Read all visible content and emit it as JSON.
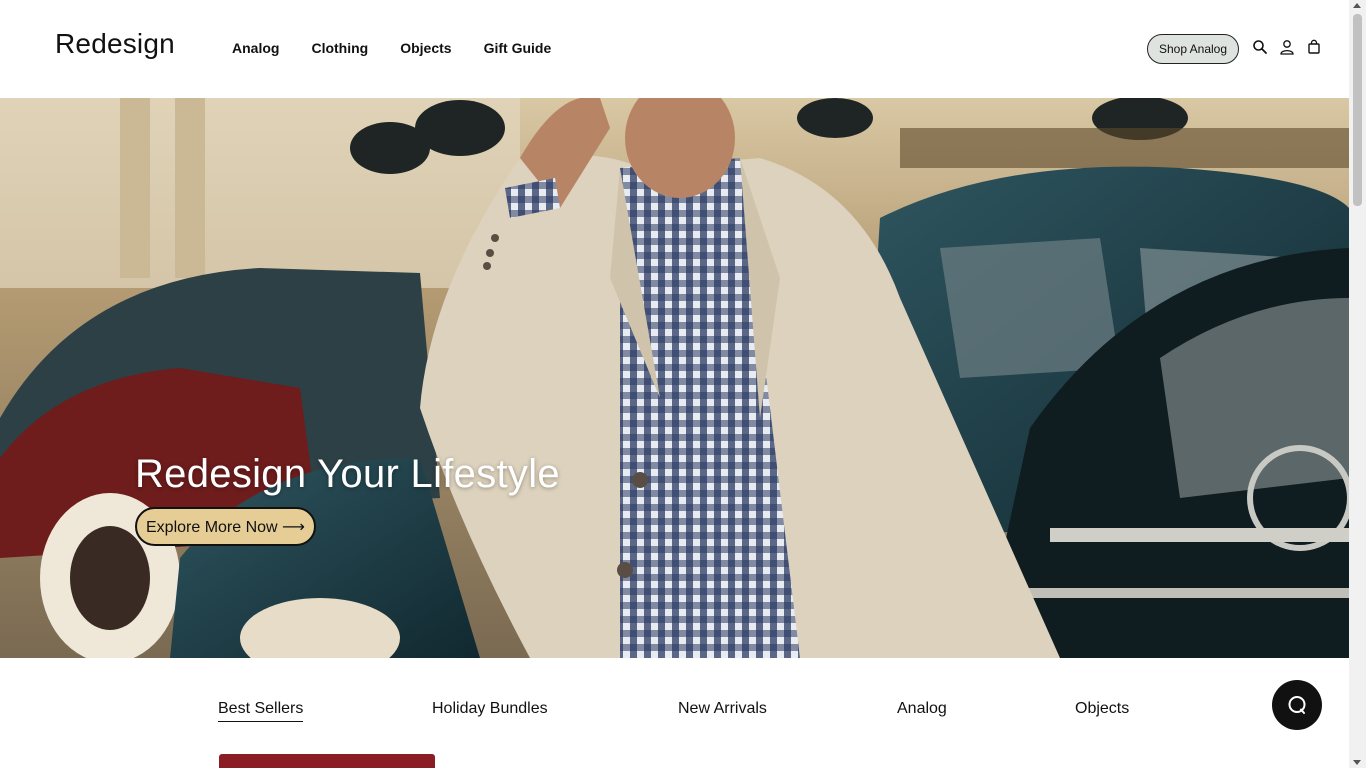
{
  "header": {
    "logo": "Redesign",
    "nav": [
      "Analog",
      "Clothing",
      "Objects",
      "Gift Guide"
    ],
    "shop_button": "Shop Analog",
    "icons": [
      "search-icon",
      "user-icon",
      "bag-icon"
    ]
  },
  "hero": {
    "title": "Redesign Your Lifestyle",
    "button": "Explore More Now ⟶"
  },
  "tabs": {
    "items": [
      "Best Sellers",
      "Holiday Bundles",
      "New Arrivals",
      "Analog",
      "Objects"
    ],
    "active": "Best Sellers"
  },
  "chat": {
    "icon": "chat-icon"
  },
  "colors": {
    "accent_button": "#e5cd95",
    "shop_button_bg": "#dfe3df",
    "chat_bg": "#111111"
  }
}
